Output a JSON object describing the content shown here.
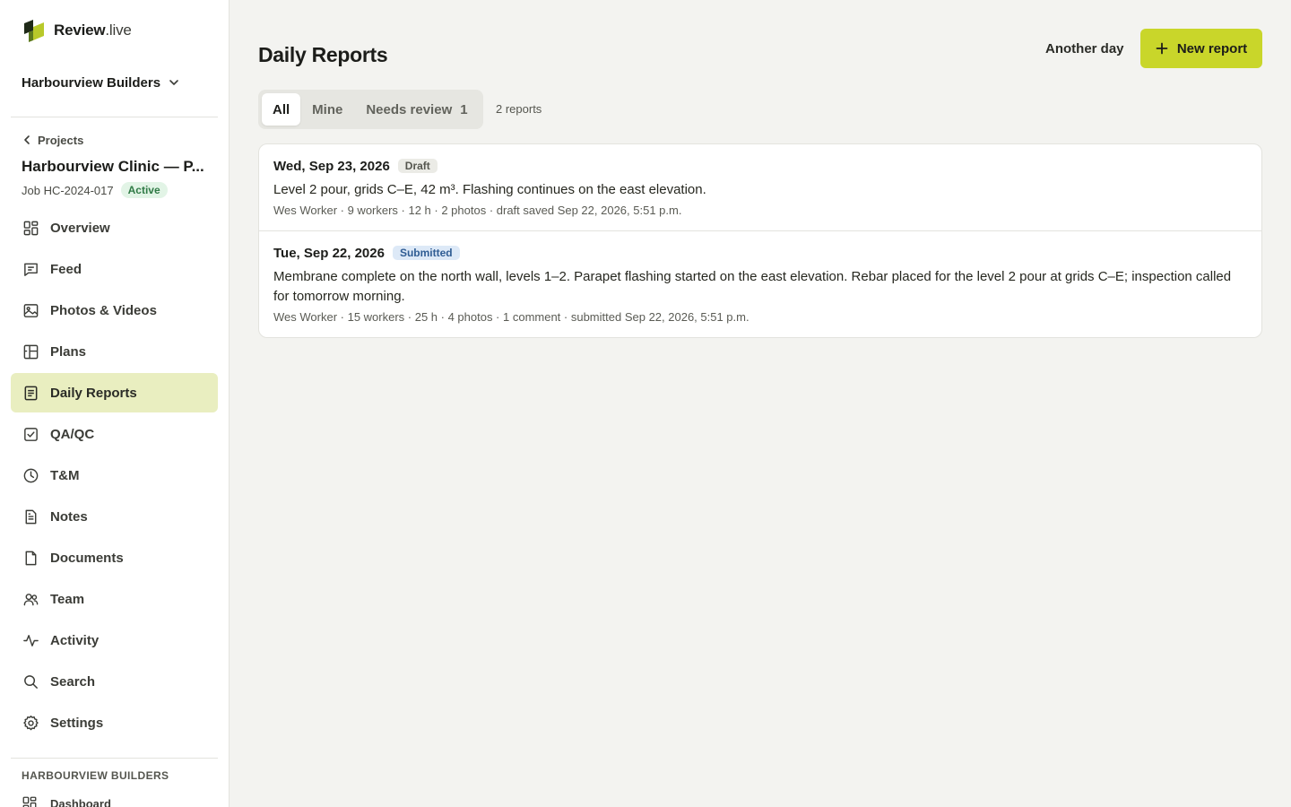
{
  "brand": {
    "name": "Review",
    "tld": ".live"
  },
  "org": {
    "name": "Harbourview Builders"
  },
  "project": {
    "back_label": "Projects",
    "name": "Harbourview Clinic — P...",
    "job": "Job HC-2024-017",
    "status": "Active"
  },
  "nav": [
    {
      "label": "Overview",
      "icon": "grid-icon"
    },
    {
      "label": "Feed",
      "icon": "message-square-icon"
    },
    {
      "label": "Photos & Videos",
      "icon": "image-icon"
    },
    {
      "label": "Plans",
      "icon": "floor-plan-icon"
    },
    {
      "label": "Daily Reports",
      "icon": "clipboard-list-icon",
      "active": true
    },
    {
      "label": "QA/QC",
      "icon": "check-square-icon"
    },
    {
      "label": "T&M",
      "icon": "clock-icon"
    },
    {
      "label": "Notes",
      "icon": "note-icon"
    },
    {
      "label": "Documents",
      "icon": "file-icon"
    },
    {
      "label": "Team",
      "icon": "users-icon"
    },
    {
      "label": "Activity",
      "icon": "activity-icon"
    },
    {
      "label": "Search",
      "icon": "search-icon"
    },
    {
      "label": "Settings",
      "icon": "gear-icon"
    }
  ],
  "org_section": {
    "label": "HARBOURVIEW BUILDERS",
    "dashboard": "Dashboard"
  },
  "header": {
    "title": "Daily Reports",
    "another_day": "Another day",
    "new_report": "New report"
  },
  "tabs": [
    {
      "label": "All",
      "active": true
    },
    {
      "label": "Mine"
    },
    {
      "label": "Needs review",
      "count": "1"
    }
  ],
  "report_count": "2 reports",
  "reports": [
    {
      "date": "Wed, Sep 23, 2026",
      "status": "Draft",
      "summary": "Level 2 pour, grids C–E, 42 m³. Flashing continues on the east elevation.",
      "meta": "Wes Worker · 9 workers · 12 h · 2 photos · draft saved Sep 22, 2026, 5:51 p.m."
    },
    {
      "date": "Tue, Sep 22, 2026",
      "status": "Submitted",
      "summary": "Membrane complete on the north wall, levels 1–2. Parapet flashing started on the east elevation. Rebar placed for the level 2 pour at grids C–E; inspection called for tomorrow morning.",
      "meta": "Wes Worker · 15 workers · 25 h · 4 photos · 1 comment · submitted Sep 22, 2026, 5:51 p.m."
    }
  ],
  "colors": {
    "accent": "#c9d62a",
    "active_nav": "#e9eec0",
    "background": "#f3f3f0"
  }
}
